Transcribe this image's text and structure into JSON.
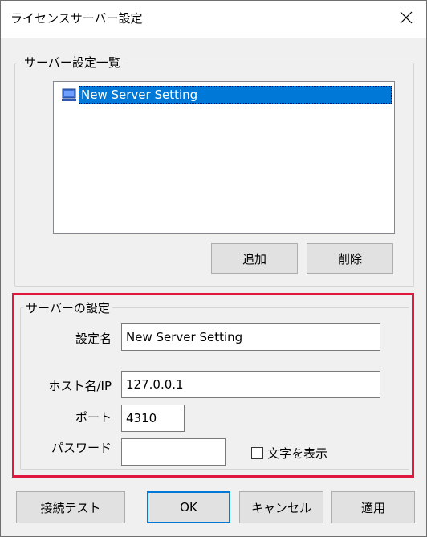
{
  "window": {
    "title": "ライセンスサーバー設定"
  },
  "server_list_group": {
    "legend": "サーバー設定一覧",
    "items": [
      {
        "label": "New Server Setting",
        "selected": true
      }
    ],
    "add_label": "追加",
    "delete_label": "削除"
  },
  "server_settings_group": {
    "legend": "サーバーの設定",
    "setting_name_label": "設定名",
    "setting_name_value": "New Server Setting",
    "host_label": "ホスト名/IP",
    "host_value": "127.0.0.1",
    "port_label": "ポート",
    "port_value": "4310",
    "password_label": "パスワード",
    "password_value": "",
    "show_text_label": "文字を表示",
    "show_text_checked": false
  },
  "footer": {
    "test_label": "接続テスト",
    "ok_label": "OK",
    "cancel_label": "キャンセル",
    "apply_label": "適用"
  },
  "colors": {
    "selection": "#0078d7",
    "highlight_border": "#e0173f"
  }
}
